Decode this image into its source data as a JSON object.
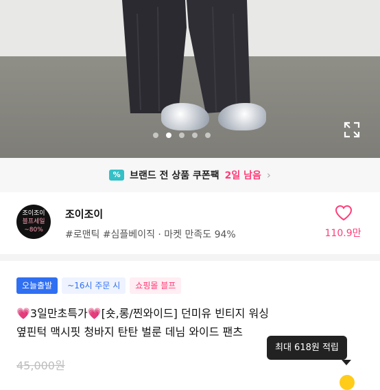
{
  "hero": {
    "carousel_dots": 5,
    "active_index": 1
  },
  "coupon": {
    "icon_label": "%",
    "text": "브랜드 전 상품 쿠폰팩",
    "days_left": "2일 남음"
  },
  "store": {
    "logo_top": "조이조이",
    "logo_mid": "블프세일",
    "logo_bottom": "~80%",
    "name": "조이조이",
    "tags": "#로맨틱 #심플베이직 · 마켓 만족도 94%",
    "likes": "110.9만"
  },
  "badges": [
    {
      "label": "오늘출발"
    },
    {
      "label": "~16시 주문 시"
    },
    {
      "label": "쇼핑몰 블프"
    }
  ],
  "product": {
    "title_prefix_emoji": "💗",
    "title_line1_a": "3일만초특가",
    "title_line1_b": "[숏,롱/찐와이드] 던미유 빈티지 워싱",
    "title_line2": "옆핀턱 맥시핏 청바지 탄탄 벌룬 데님 와이드 팬츠",
    "original_price": "45,000원"
  },
  "tooltip": {
    "text": "최대 618원 적립"
  },
  "colors": {
    "accent_pink": "#ff3c78",
    "accent_blue": "#2f6ff2",
    "coupon_teal": "#35c0c6"
  }
}
